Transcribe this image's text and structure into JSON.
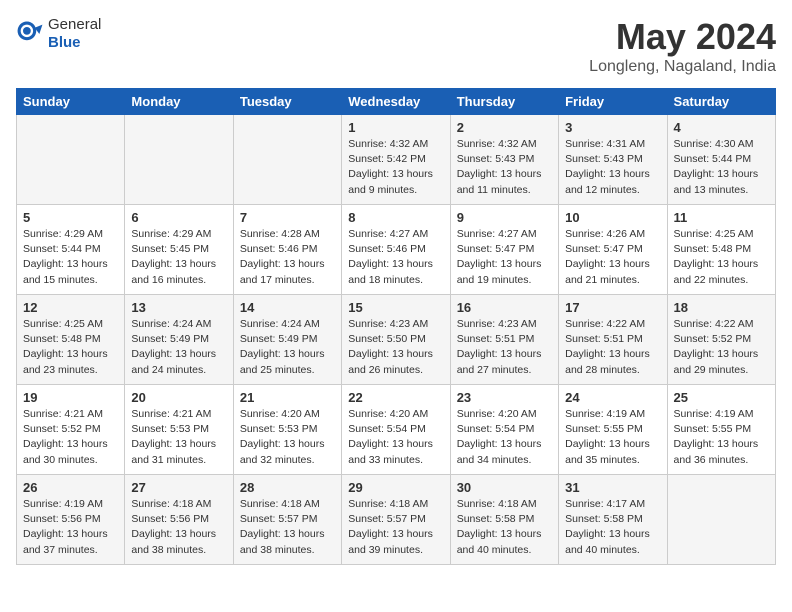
{
  "header": {
    "logo": {
      "general": "General",
      "blue": "Blue"
    },
    "title": "May 2024",
    "location": "Longleng, Nagaland, India"
  },
  "days_of_week": [
    "Sunday",
    "Monday",
    "Tuesday",
    "Wednesday",
    "Thursday",
    "Friday",
    "Saturday"
  ],
  "weeks": [
    [
      {
        "day": "",
        "info": ""
      },
      {
        "day": "",
        "info": ""
      },
      {
        "day": "",
        "info": ""
      },
      {
        "day": "1",
        "info": "Sunrise: 4:32 AM\nSunset: 5:42 PM\nDaylight: 13 hours\nand 9 minutes."
      },
      {
        "day": "2",
        "info": "Sunrise: 4:32 AM\nSunset: 5:43 PM\nDaylight: 13 hours\nand 11 minutes."
      },
      {
        "day": "3",
        "info": "Sunrise: 4:31 AM\nSunset: 5:43 PM\nDaylight: 13 hours\nand 12 minutes."
      },
      {
        "day": "4",
        "info": "Sunrise: 4:30 AM\nSunset: 5:44 PM\nDaylight: 13 hours\nand 13 minutes."
      }
    ],
    [
      {
        "day": "5",
        "info": "Sunrise: 4:29 AM\nSunset: 5:44 PM\nDaylight: 13 hours\nand 15 minutes."
      },
      {
        "day": "6",
        "info": "Sunrise: 4:29 AM\nSunset: 5:45 PM\nDaylight: 13 hours\nand 16 minutes."
      },
      {
        "day": "7",
        "info": "Sunrise: 4:28 AM\nSunset: 5:46 PM\nDaylight: 13 hours\nand 17 minutes."
      },
      {
        "day": "8",
        "info": "Sunrise: 4:27 AM\nSunset: 5:46 PM\nDaylight: 13 hours\nand 18 minutes."
      },
      {
        "day": "9",
        "info": "Sunrise: 4:27 AM\nSunset: 5:47 PM\nDaylight: 13 hours\nand 19 minutes."
      },
      {
        "day": "10",
        "info": "Sunrise: 4:26 AM\nSunset: 5:47 PM\nDaylight: 13 hours\nand 21 minutes."
      },
      {
        "day": "11",
        "info": "Sunrise: 4:25 AM\nSunset: 5:48 PM\nDaylight: 13 hours\nand 22 minutes."
      }
    ],
    [
      {
        "day": "12",
        "info": "Sunrise: 4:25 AM\nSunset: 5:48 PM\nDaylight: 13 hours\nand 23 minutes."
      },
      {
        "day": "13",
        "info": "Sunrise: 4:24 AM\nSunset: 5:49 PM\nDaylight: 13 hours\nand 24 minutes."
      },
      {
        "day": "14",
        "info": "Sunrise: 4:24 AM\nSunset: 5:49 PM\nDaylight: 13 hours\nand 25 minutes."
      },
      {
        "day": "15",
        "info": "Sunrise: 4:23 AM\nSunset: 5:50 PM\nDaylight: 13 hours\nand 26 minutes."
      },
      {
        "day": "16",
        "info": "Sunrise: 4:23 AM\nSunset: 5:51 PM\nDaylight: 13 hours\nand 27 minutes."
      },
      {
        "day": "17",
        "info": "Sunrise: 4:22 AM\nSunset: 5:51 PM\nDaylight: 13 hours\nand 28 minutes."
      },
      {
        "day": "18",
        "info": "Sunrise: 4:22 AM\nSunset: 5:52 PM\nDaylight: 13 hours\nand 29 minutes."
      }
    ],
    [
      {
        "day": "19",
        "info": "Sunrise: 4:21 AM\nSunset: 5:52 PM\nDaylight: 13 hours\nand 30 minutes."
      },
      {
        "day": "20",
        "info": "Sunrise: 4:21 AM\nSunset: 5:53 PM\nDaylight: 13 hours\nand 31 minutes."
      },
      {
        "day": "21",
        "info": "Sunrise: 4:20 AM\nSunset: 5:53 PM\nDaylight: 13 hours\nand 32 minutes."
      },
      {
        "day": "22",
        "info": "Sunrise: 4:20 AM\nSunset: 5:54 PM\nDaylight: 13 hours\nand 33 minutes."
      },
      {
        "day": "23",
        "info": "Sunrise: 4:20 AM\nSunset: 5:54 PM\nDaylight: 13 hours\nand 34 minutes."
      },
      {
        "day": "24",
        "info": "Sunrise: 4:19 AM\nSunset: 5:55 PM\nDaylight: 13 hours\nand 35 minutes."
      },
      {
        "day": "25",
        "info": "Sunrise: 4:19 AM\nSunset: 5:55 PM\nDaylight: 13 hours\nand 36 minutes."
      }
    ],
    [
      {
        "day": "26",
        "info": "Sunrise: 4:19 AM\nSunset: 5:56 PM\nDaylight: 13 hours\nand 37 minutes."
      },
      {
        "day": "27",
        "info": "Sunrise: 4:18 AM\nSunset: 5:56 PM\nDaylight: 13 hours\nand 38 minutes."
      },
      {
        "day": "28",
        "info": "Sunrise: 4:18 AM\nSunset: 5:57 PM\nDaylight: 13 hours\nand 38 minutes."
      },
      {
        "day": "29",
        "info": "Sunrise: 4:18 AM\nSunset: 5:57 PM\nDaylight: 13 hours\nand 39 minutes."
      },
      {
        "day": "30",
        "info": "Sunrise: 4:18 AM\nSunset: 5:58 PM\nDaylight: 13 hours\nand 40 minutes."
      },
      {
        "day": "31",
        "info": "Sunrise: 4:17 AM\nSunset: 5:58 PM\nDaylight: 13 hours\nand 40 minutes."
      },
      {
        "day": "",
        "info": ""
      }
    ]
  ]
}
